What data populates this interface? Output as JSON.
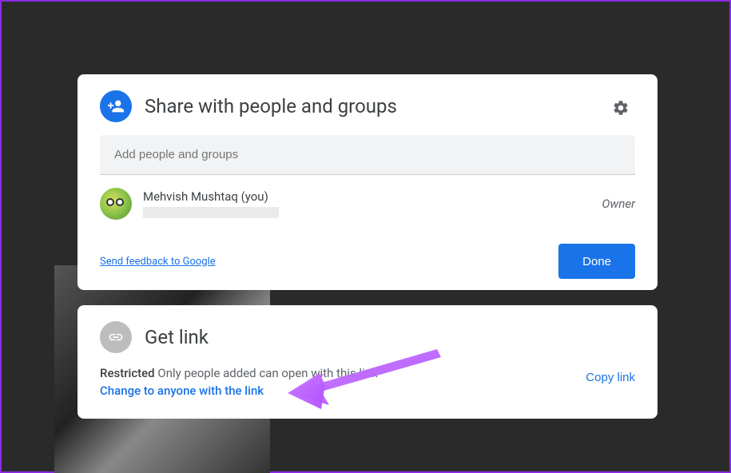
{
  "share_card": {
    "title": "Share with people and groups",
    "input_placeholder": "Add people and groups",
    "person": {
      "name": "Mehvish Mushtaq (you)",
      "role": "Owner"
    },
    "feedback_label": "Send feedback to Google",
    "done_label": "Done"
  },
  "link_card": {
    "title": "Get link",
    "restricted_label": "Restricted",
    "restricted_desc": "Only people added can open with this link",
    "change_label": "Change to anyone with the link",
    "copy_label": "Copy link"
  }
}
